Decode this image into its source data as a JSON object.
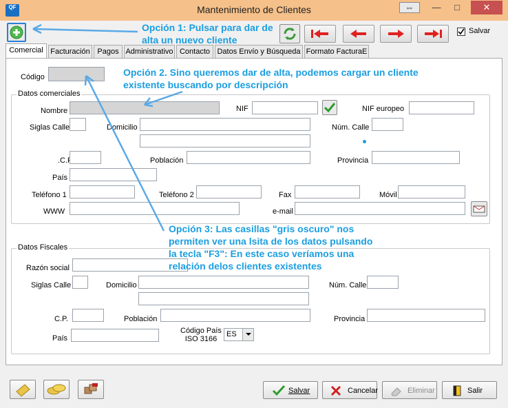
{
  "window": {
    "title": "Mantenimiento de Clientes",
    "logo_text": "QF"
  },
  "titlebar_buttons": {
    "restore": "⇔",
    "minimize": "—",
    "maximize": "□",
    "close": "✕"
  },
  "toolbar": {
    "save_check_label": "Salvar"
  },
  "tabs": [
    "Comercial",
    "Facturación",
    "Pagos",
    "Administrativo",
    "Contacto",
    "Datos Envío y Búsqueda",
    "Formato FacturaE"
  ],
  "codigo_label": "Código",
  "comerciales": {
    "legend": "Datos comerciales",
    "nombre": "Nombre",
    "nif": "NIF",
    "nif_europeo": "NIF europeo",
    "siglas_calle": "Siglas Calle",
    "domicilio": "Domicilio",
    "num_calle": "Núm. Calle",
    "cp": ".C.P.",
    "poblacion": "Población",
    "provincia": "Provincia",
    "pais": "País",
    "telefono1": "Teléfono 1",
    "telefono2": "Teléfono 2",
    "fax": "Fax",
    "movil": "Móvil",
    "www": "WWW",
    "email": "e-mail"
  },
  "fiscales": {
    "legend": "Datos Fiscales",
    "razon_social": "Razón social",
    "siglas_calle": "Siglas Calle",
    "domicilio": "Domicilio",
    "num_calle": "Núm. Calle",
    "cp": "C.P.",
    "poblacion": "Población",
    "provincia": "Provincia",
    "pais": "País",
    "codigo_pais_1": "Código País",
    "codigo_pais_2": "ISO 3166",
    "codigo_pais_value": "ES"
  },
  "annotations": {
    "op1_line1": "Opción 1: Pulsar para dar de",
    "op1_line2": "alta un nuevo cliente",
    "op2_line1": "Opción 2. Sino queremos dar de alta, podemos cargar un cliente",
    "op2_line2": "existente buscando por descripción",
    "op3_line1": "Opción 3: Las casillas \"gris oscuro\" nos",
    "op3_line2": "permiten ver una lsita de los datos pulsando",
    "op3_line3": "la tecla \"F3\": En este caso veríamos una",
    "op3_line4": "relación delos clientes existentes"
  },
  "bottom_buttons": {
    "salvar": "Salvar",
    "cancelar": "Cancelar",
    "eliminar": "Eliminar",
    "salir": "Salir"
  },
  "colors": {
    "annotation": "#1a9ee0",
    "titlebar": "#f5c089",
    "nav_red": "#e02020",
    "ok_green": "#2e9a2e"
  }
}
